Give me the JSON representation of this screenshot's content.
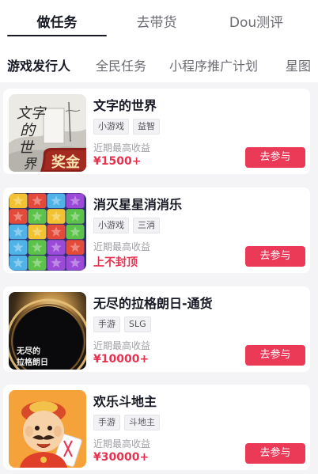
{
  "tabs": [
    {
      "label": "做任务",
      "active": true
    },
    {
      "label": "去带货",
      "active": false
    },
    {
      "label": "Dou测评",
      "active": false
    }
  ],
  "subtabs": [
    {
      "label": "游戏发行人",
      "active": true
    },
    {
      "label": "全民任务",
      "active": false
    },
    {
      "label": "小程序推广计划",
      "active": false
    },
    {
      "label": "星图",
      "active": false
    }
  ],
  "tasks": [
    {
      "title": "文字的世界",
      "tags": [
        "小游戏",
        "益智"
      ],
      "reward_label": "近期最高收益",
      "reward": "¥1500+",
      "button": "去参与",
      "thumb": {
        "name": "wenzi-world-cover",
        "text": "文字的世界",
        "badge": "奖金"
      }
    },
    {
      "title": "消灭星星消消乐",
      "tags": [
        "小游戏",
        "三消"
      ],
      "reward_label": "近期最高收益",
      "reward": "上不封顶",
      "button": "去参与",
      "thumb": {
        "name": "star-blocks-cover"
      }
    },
    {
      "title": "无尽的拉格朗日-通货",
      "tags": [
        "手游",
        "SLG"
      ],
      "reward_label": "近期最高收益",
      "reward": "¥10000+",
      "button": "去参与",
      "thumb": {
        "name": "lagrange-cover",
        "text": "无尽的拉格朗日"
      }
    },
    {
      "title": "欢乐斗地主",
      "tags": [
        "手游",
        "斗地主"
      ],
      "reward_label": "近期最高收益",
      "reward": "¥30000+",
      "button": "去参与",
      "thumb": {
        "name": "doudizhu-cover"
      }
    }
  ],
  "colors": {
    "accent": "#ea3a58",
    "reward": "#e8314f",
    "text": "#161823",
    "muted": "#a0a1a6"
  }
}
